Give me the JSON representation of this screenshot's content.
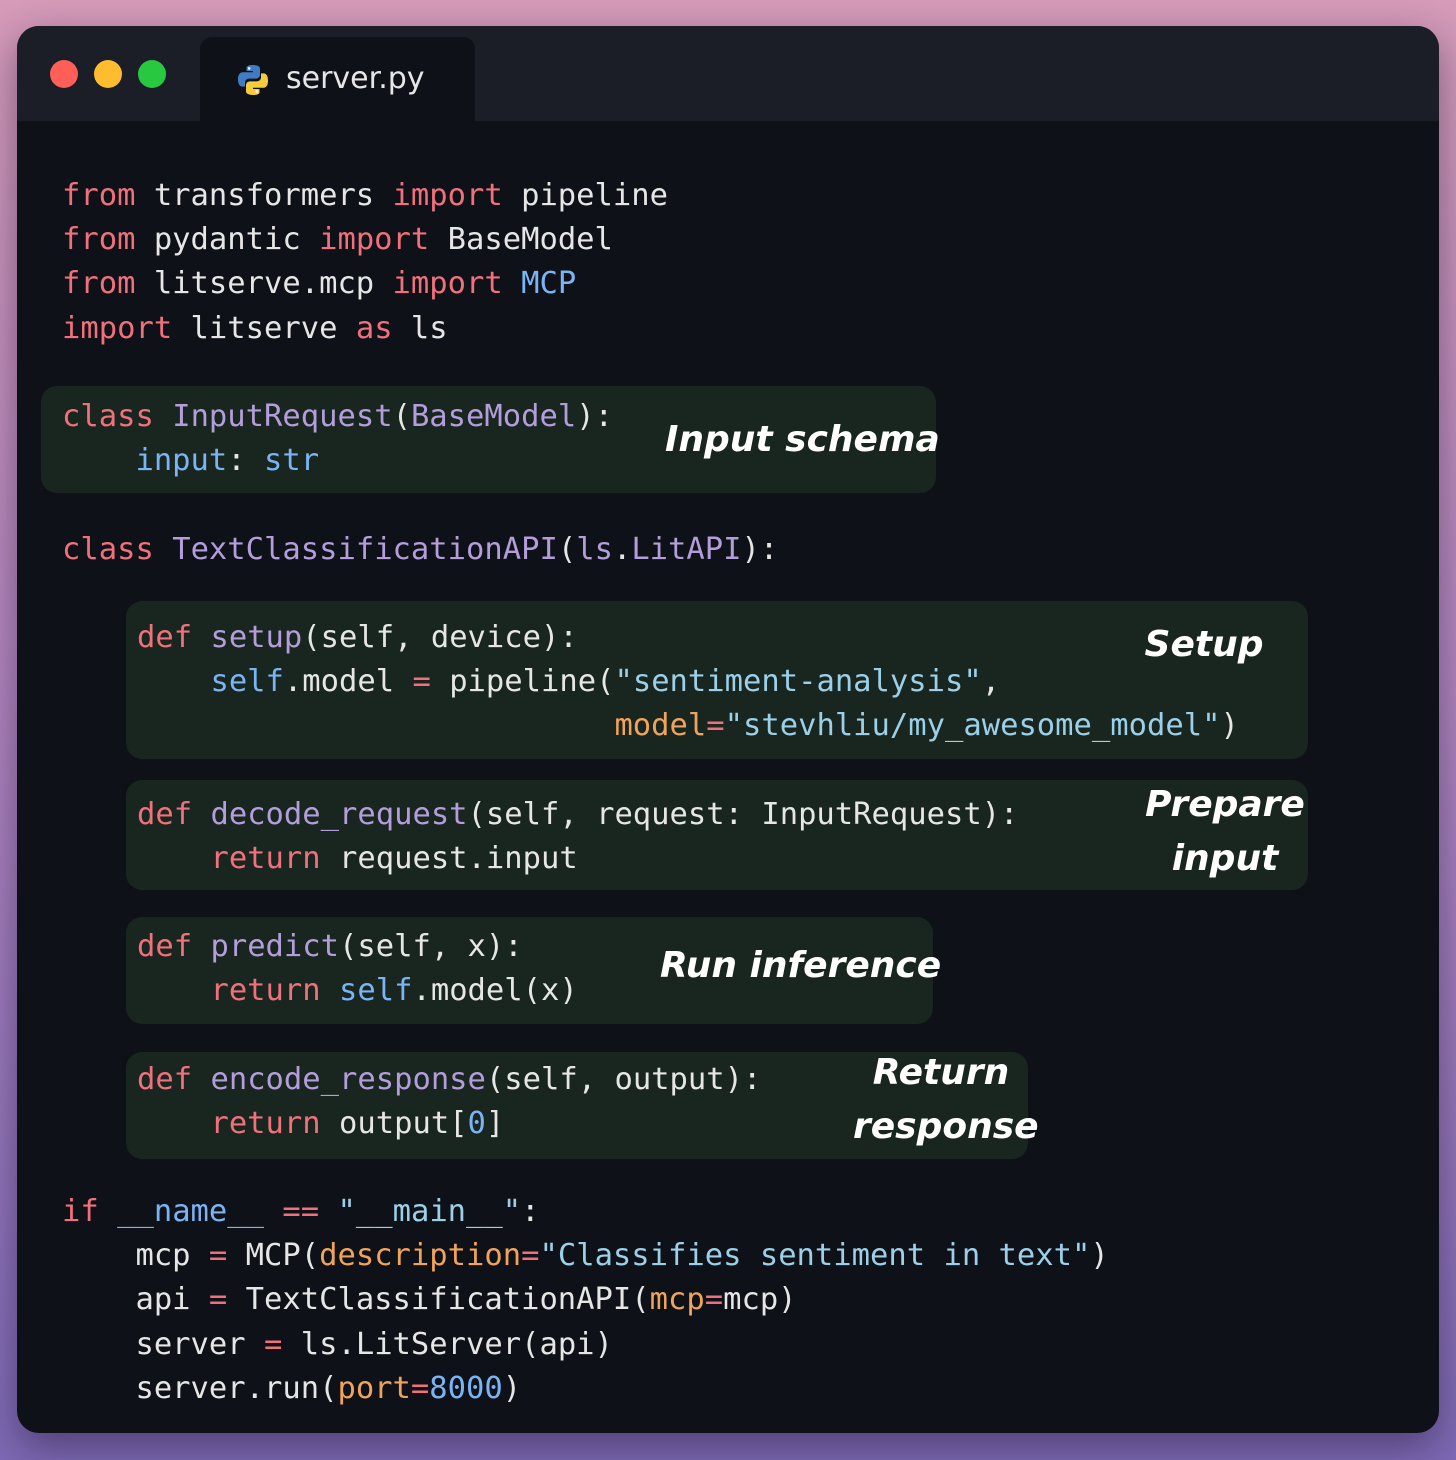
{
  "window": {
    "tab_title": "server.py",
    "tab_icon": "python-icon",
    "traffic_lights": {
      "close": "#ff5f57",
      "minimize": "#febc2e",
      "maximize": "#28c840"
    }
  },
  "code": {
    "imports": [
      [
        {
          "c": "k",
          "t": "from"
        },
        {
          "t": " transformers "
        },
        {
          "c": "k",
          "t": "import"
        },
        {
          "t": " pipeline"
        }
      ],
      [
        {
          "c": "k",
          "t": "from"
        },
        {
          "t": " pydantic "
        },
        {
          "c": "k",
          "t": "import"
        },
        {
          "t": " BaseModel"
        }
      ],
      [
        {
          "c": "k",
          "t": "from"
        },
        {
          "t": " litserve.mcp "
        },
        {
          "c": "k",
          "t": "import"
        },
        {
          "t": " "
        },
        {
          "c": "b",
          "t": "MCP"
        }
      ],
      [
        {
          "c": "k",
          "t": "import"
        },
        {
          "t": " litserve "
        },
        {
          "c": "k",
          "t": "as"
        },
        {
          "t": " ls"
        }
      ]
    ],
    "input_schema": [
      [
        {
          "c": "k",
          "t": "class"
        },
        {
          "t": " "
        },
        {
          "c": "f",
          "t": "InputRequest"
        },
        {
          "t": "("
        },
        {
          "c": "f",
          "t": "BaseModel"
        },
        {
          "t": "):"
        }
      ],
      [
        {
          "t": "    "
        },
        {
          "c": "b",
          "t": "input"
        },
        {
          "t": ": "
        },
        {
          "c": "b",
          "t": "str"
        }
      ]
    ],
    "class_def": [
      [
        {
          "c": "k",
          "t": "class"
        },
        {
          "t": " "
        },
        {
          "c": "f",
          "t": "TextClassificationAPI"
        },
        {
          "t": "("
        },
        {
          "c": "f",
          "t": "ls"
        },
        {
          "t": "."
        },
        {
          "c": "f",
          "t": "LitAPI"
        },
        {
          "t": "):"
        }
      ]
    ],
    "setup": [
      [
        {
          "c": "k",
          "t": "def"
        },
        {
          "t": " "
        },
        {
          "c": "f",
          "t": "setup"
        },
        {
          "t": "(self, device):"
        }
      ],
      [
        {
          "t": "    "
        },
        {
          "c": "b",
          "t": "self"
        },
        {
          "t": ".model "
        },
        {
          "c": "k",
          "t": "="
        },
        {
          "t": " pipeline("
        },
        {
          "c": "s",
          "t": "\"sentiment-analysis\""
        },
        {
          "t": ","
        }
      ],
      [
        {
          "t": "                          "
        },
        {
          "c": "o",
          "t": "model"
        },
        {
          "c": "k",
          "t": "="
        },
        {
          "c": "s",
          "t": "\"stevhliu/my_awesome_model\""
        },
        {
          "t": ")"
        }
      ]
    ],
    "decode_request": [
      [
        {
          "c": "k",
          "t": "def"
        },
        {
          "t": " "
        },
        {
          "c": "f",
          "t": "decode_request"
        },
        {
          "t": "(self, request: InputRequest):"
        }
      ],
      [
        {
          "t": "    "
        },
        {
          "c": "k",
          "t": "return"
        },
        {
          "t": " request.input"
        }
      ]
    ],
    "predict": [
      [
        {
          "c": "k",
          "t": "def"
        },
        {
          "t": " "
        },
        {
          "c": "f",
          "t": "predict"
        },
        {
          "t": "(self, x):"
        }
      ],
      [
        {
          "t": "    "
        },
        {
          "c": "k",
          "t": "return"
        },
        {
          "t": " "
        },
        {
          "c": "b",
          "t": "self"
        },
        {
          "t": ".model(x)"
        }
      ]
    ],
    "encode_response": [
      [
        {
          "c": "k",
          "t": "def"
        },
        {
          "t": " "
        },
        {
          "c": "f",
          "t": "encode_response"
        },
        {
          "t": "(self, output):"
        }
      ],
      [
        {
          "t": "    "
        },
        {
          "c": "k",
          "t": "return"
        },
        {
          "t": " output["
        },
        {
          "c": "b",
          "t": "0"
        },
        {
          "t": "]"
        }
      ]
    ],
    "main": [
      [
        {
          "c": "k",
          "t": "if"
        },
        {
          "t": " "
        },
        {
          "c": "b",
          "t": "__name__"
        },
        {
          "t": " "
        },
        {
          "c": "k",
          "t": "=="
        },
        {
          "t": " "
        },
        {
          "c": "s",
          "t": "\"__main__\""
        },
        {
          "t": ":"
        }
      ],
      [
        {
          "t": "    mcp "
        },
        {
          "c": "k",
          "t": "="
        },
        {
          "t": " MCP("
        },
        {
          "c": "o",
          "t": "description"
        },
        {
          "c": "k",
          "t": "="
        },
        {
          "c": "s",
          "t": "\"Classifies sentiment in text\""
        },
        {
          "t": ")"
        }
      ],
      [
        {
          "t": "    api "
        },
        {
          "c": "k",
          "t": "="
        },
        {
          "t": " TextClassificationAPI("
        },
        {
          "c": "o",
          "t": "mcp"
        },
        {
          "c": "k",
          "t": "="
        },
        {
          "t": "mcp)"
        }
      ],
      [
        {
          "t": "    server "
        },
        {
          "c": "k",
          "t": "="
        },
        {
          "t": " ls.LitServer(api)"
        }
      ],
      [
        {
          "t": "    server.run("
        },
        {
          "c": "o",
          "t": "port"
        },
        {
          "c": "k",
          "t": "="
        },
        {
          "c": "b",
          "t": "8000"
        },
        {
          "t": ")"
        }
      ]
    ]
  },
  "annotations": {
    "input_schema": "Input schema",
    "setup": "Setup",
    "prepare_input": "Prepare\ninput",
    "run_inference": "Run inference",
    "return_response": "Return\nresponse"
  }
}
